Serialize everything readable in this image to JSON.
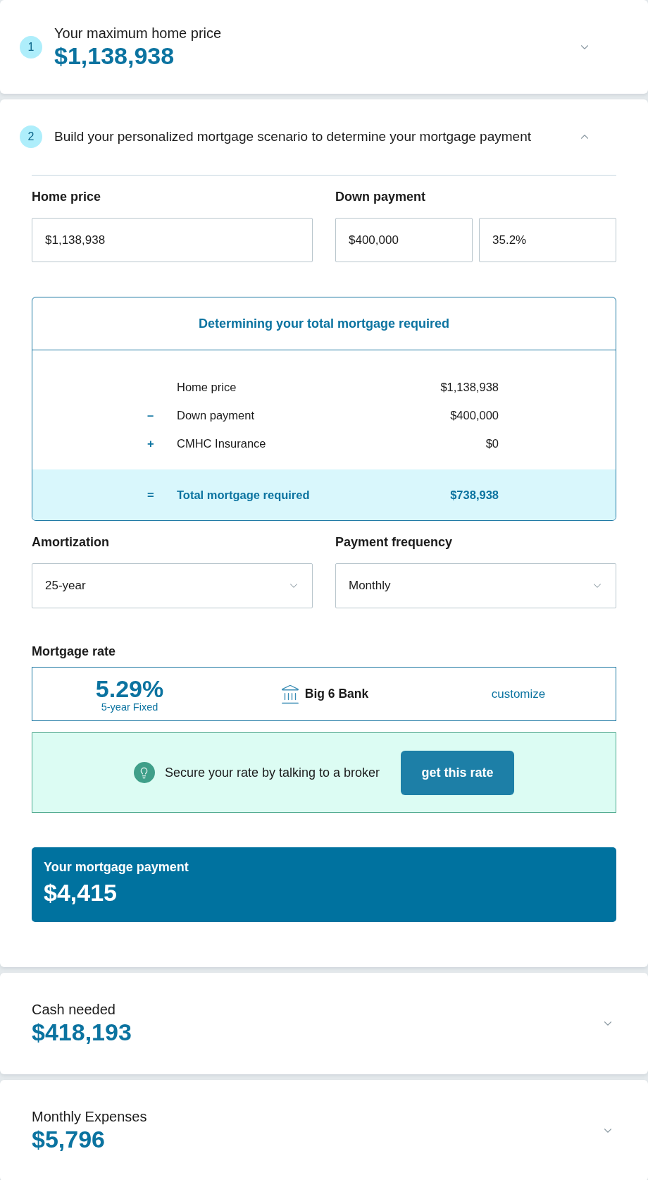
{
  "max_price": {
    "step": "1",
    "label": "Your maximum home price",
    "value": "$1,138,938",
    "expanded": false
  },
  "scenario": {
    "step": "2",
    "title": "Build your personalized mortgage scenario to determine your mortgage payment",
    "expanded": true,
    "home_price": {
      "label": "Home price",
      "value": "$1,138,938"
    },
    "down_payment": {
      "label": "Down payment",
      "amount": "$400,000",
      "percent": "35.2%"
    },
    "breakdown": {
      "title": "Determining your total mortgage required",
      "rows": [
        {
          "label": "Home price",
          "value": "$1,138,938"
        },
        {
          "sign": "–",
          "label": "Down payment",
          "value": "$400,000"
        },
        {
          "sign": "+",
          "label": "CMHC Insurance",
          "value": "$0"
        }
      ],
      "total": {
        "sign": "=",
        "label": "Total mortgage required",
        "value": "$738,938"
      }
    },
    "selects": [
      {
        "label": "Amortization",
        "value": "25-year"
      },
      {
        "label": "Payment frequency",
        "value": "Monthly"
      }
    ],
    "mortgage_rate": {
      "label": "Mortgage rate",
      "rate": "5.29%",
      "term": "5-year Fixed",
      "lender": "Big 6 Bank",
      "link": "customize"
    },
    "broker": {
      "text": "Secure your rate by talking to a broker",
      "button": "get this rate"
    },
    "payment": {
      "label": "Your mortgage payment",
      "value": "$4,415"
    }
  },
  "summaries": [
    {
      "label": "Cash needed",
      "value": "$418,193",
      "expanded": false
    },
    {
      "label": "Monthly Expenses",
      "value": "$5,796",
      "expanded": false
    }
  ]
}
